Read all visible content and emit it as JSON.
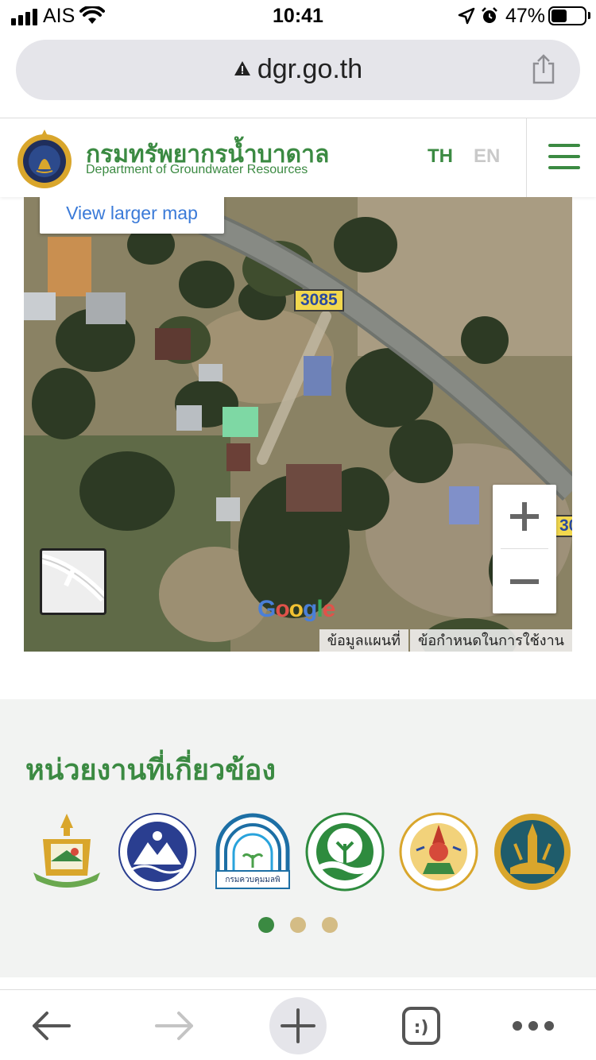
{
  "status_bar": {
    "carrier": "AIS",
    "time": "10:41",
    "battery_percent": "47%",
    "battery_level": 0.47,
    "icons": [
      "signal-icon",
      "wifi-icon",
      "location-icon",
      "alarm-icon",
      "battery-icon"
    ]
  },
  "browser": {
    "url": "dgr.go.th",
    "security_icon": "warning-icon",
    "share_icon": "share-icon"
  },
  "header": {
    "title_th": "กรมทรัพยากรน้ำบาดาล",
    "title_en": "Department of Groundwater Resources",
    "lang_th": "TH",
    "lang_en": "EN",
    "menu_icon": "hamburger-icon",
    "brand_color": "#3b8a42"
  },
  "map": {
    "view_larger": "View larger map",
    "road_label": "3085",
    "road_label_partial": "30",
    "google": "Google",
    "map_data": "ข้อมูลแผนที่",
    "terms": "ข้อกำหนดในการใช้งาน"
  },
  "related": {
    "title": "หน่วยงานที่เกี่ยวข้อง",
    "partners": [
      "provincial-emblem-logo",
      "water-resources-dept-logo",
      "pollution-control-dept-logo",
      "environmental-quality-dept-logo",
      "national-parks-dept-logo",
      "royal-forest-dept-logo"
    ],
    "partner_logo_text": "กรมควบคุมมลพิ",
    "active_page": 1,
    "page_count": 3
  },
  "toolbar": {
    "icons": [
      "back-arrow-icon",
      "forward-arrow-icon",
      "new-tab-plus-icon",
      "tabs-icon",
      "more-dots-icon"
    ],
    "tabs_label": ":)"
  }
}
